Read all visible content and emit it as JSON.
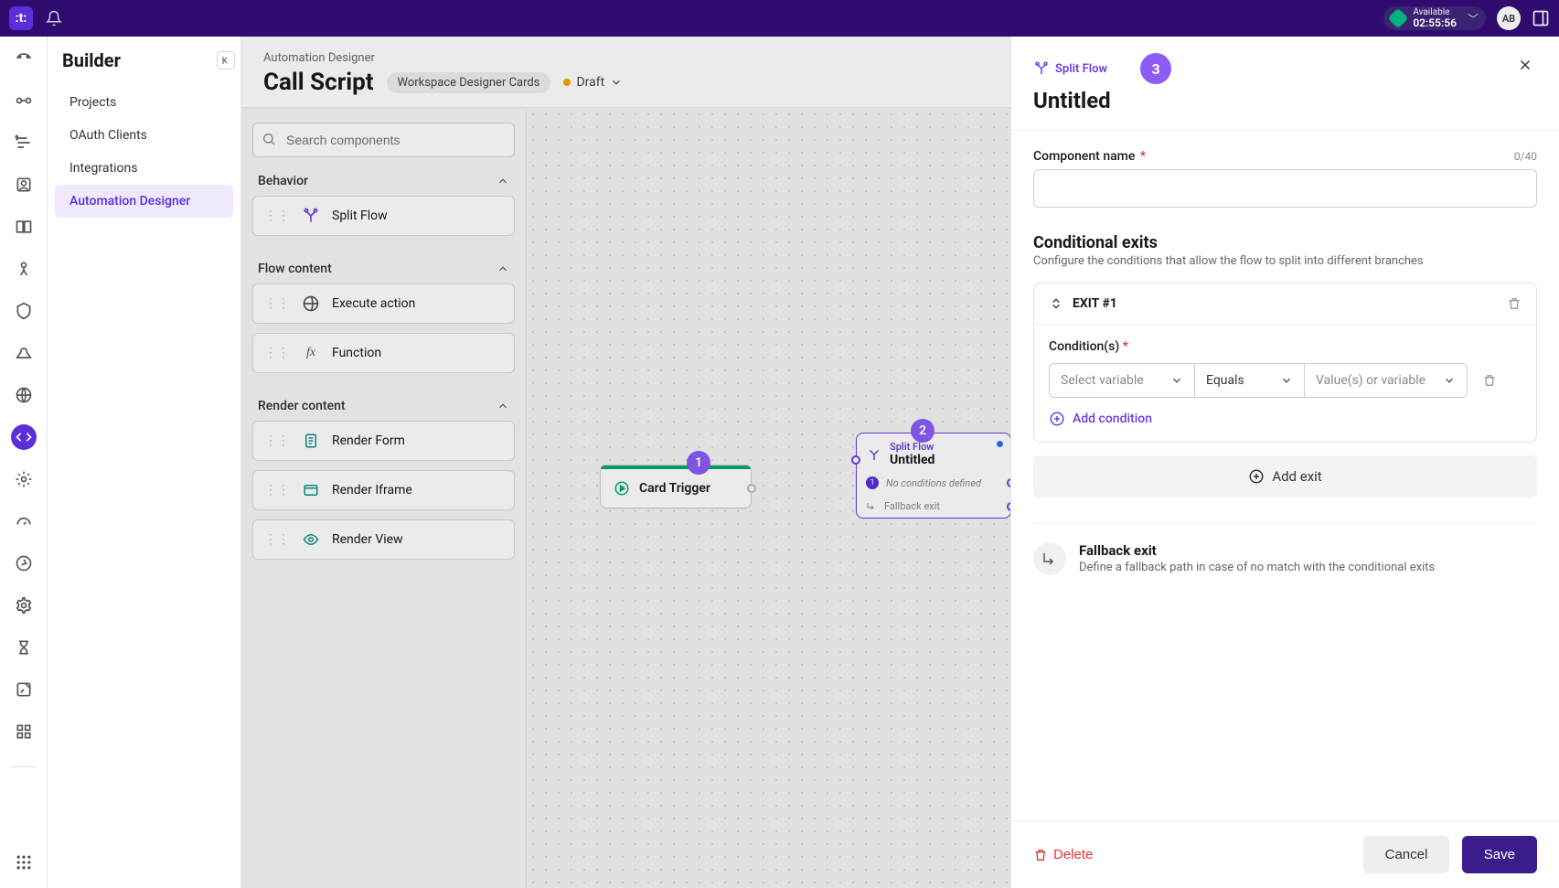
{
  "topbar": {
    "logo": ":t:",
    "status_label": "Available",
    "status_timer": "02:55:56",
    "user_initials": "AB"
  },
  "builder": {
    "title": "Builder",
    "items": {
      "projects": "Projects",
      "oauth": "OAuth Clients",
      "integrations": "Integrations",
      "automation": "Automation Designer"
    }
  },
  "header": {
    "breadcrumb": "Automation Designer",
    "title": "Call Script",
    "chip": "Workspace Designer Cards",
    "status": "Draft"
  },
  "components": {
    "search_placeholder": "Search components",
    "behavior_hdr": "Behavior",
    "split_flow": "Split Flow",
    "flow_content_hdr": "Flow content",
    "execute_action": "Execute action",
    "function": "Function",
    "render_content_hdr": "Render content",
    "render_form": "Render Form",
    "render_iframe": "Render Iframe",
    "render_view": "Render View"
  },
  "canvas": {
    "card_trigger": "Card Trigger",
    "split_tag": "Split Flow",
    "split_name": "Untitled",
    "no_cond": "No conditions defined",
    "fallback": "Fallback exit",
    "co1": "1",
    "co2": "2",
    "branch1": "1"
  },
  "panel": {
    "tag": "Split Flow",
    "title": "Untitled",
    "badge": "3",
    "name_label": "Component name",
    "name_count": "0/40",
    "cond_title": "Conditional exits",
    "cond_sub": "Configure the conditions that allow the flow to split into different branches",
    "exit1": "EXIT #1",
    "cond_label": "Condition(s)",
    "select_var": "Select variable",
    "equals": "Equals",
    "values": "Value(s) or variable",
    "add_cond": "Add condition",
    "add_exit": "Add exit",
    "fallback_title": "Fallback exit",
    "fallback_sub": "Define a fallback path in case of no match with the conditional exits",
    "delete": "Delete",
    "cancel": "Cancel",
    "save": "Save"
  }
}
